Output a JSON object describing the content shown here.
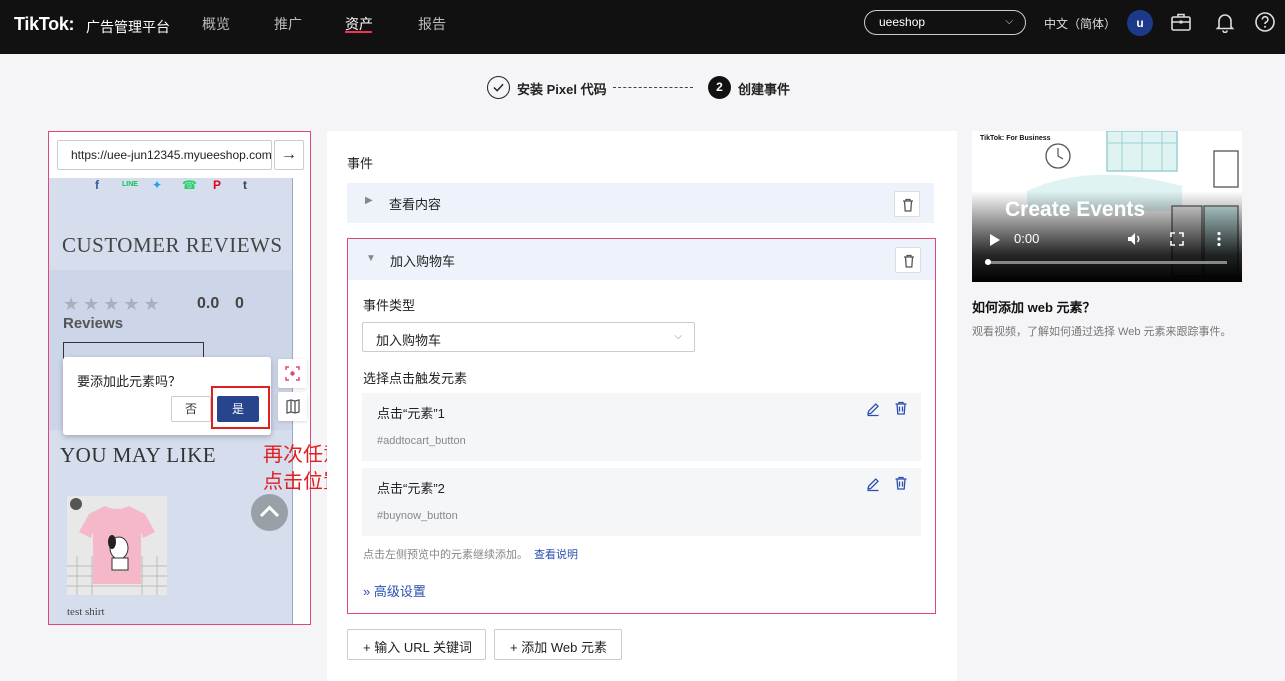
{
  "header": {
    "brand": "TikTok:",
    "brand_sub": "广告管理平台",
    "nav": [
      "概览",
      "推广",
      "资产",
      "报告"
    ],
    "active_nav": "资产",
    "shop": "ueeshop",
    "language": "中文（简体）",
    "avatar_letter": "u",
    "icons": [
      "briefcase-icon",
      "bell-icon",
      "help-icon"
    ]
  },
  "stepper": {
    "step1": "安装 Pixel 代码",
    "step2_number": "2",
    "step2": "创建事件"
  },
  "preview": {
    "url": "https://uee-jun12345.myueeshop.com",
    "social_icons": [
      "f",
      "LINE",
      "twitter",
      "whatsapp",
      "P",
      "t"
    ],
    "customer_reviews_title": "CUSTOMER REVIEWS",
    "stars": "★★★★★",
    "rating": "0.0",
    "review_count": "0",
    "reviews_word": "Reviews",
    "you_may_like_title": "YOU MAY LIKE",
    "product_name": "test shirt",
    "popup": {
      "question": "要添加此元素吗？",
      "no": "否",
      "yes": "是"
    },
    "annotation_line1": "再次任意",
    "annotation_line2": "点击位置"
  },
  "events": {
    "label": "事件",
    "collapsed_event": "查看内容",
    "expanded_event": "加入购物车",
    "event_type_label": "事件类型",
    "event_type_value": "加入购物车",
    "trigger_label": "选择点击触发元素",
    "elements": [
      {
        "title": "点击“元素”1",
        "selector": "#addtocart_button"
      },
      {
        "title": "点击“元素”2",
        "selector": "#buynow_button"
      }
    ],
    "hint": "点击左侧预览中的元素继续添加。",
    "hint_link": "查看说明",
    "advanced": "高级设置",
    "add_url_button": "输入 URL 关键词",
    "add_web_button": "添加 Web 元素"
  },
  "video": {
    "brand": "TikTok: For Business",
    "title": "Create Events",
    "time": "0:00",
    "progress": 0
  },
  "help": {
    "title": "如何添加 web 元素？",
    "desc": "观看视频，了解如何通过选择 Web 元素来跟踪事件。"
  },
  "colors": {
    "accent_pink": "#fe2c55",
    "highlight_border": "#e0457b",
    "primary_blue": "#27448d",
    "link_blue": "#2a4fb0",
    "annotation_red": "#e02020"
  }
}
